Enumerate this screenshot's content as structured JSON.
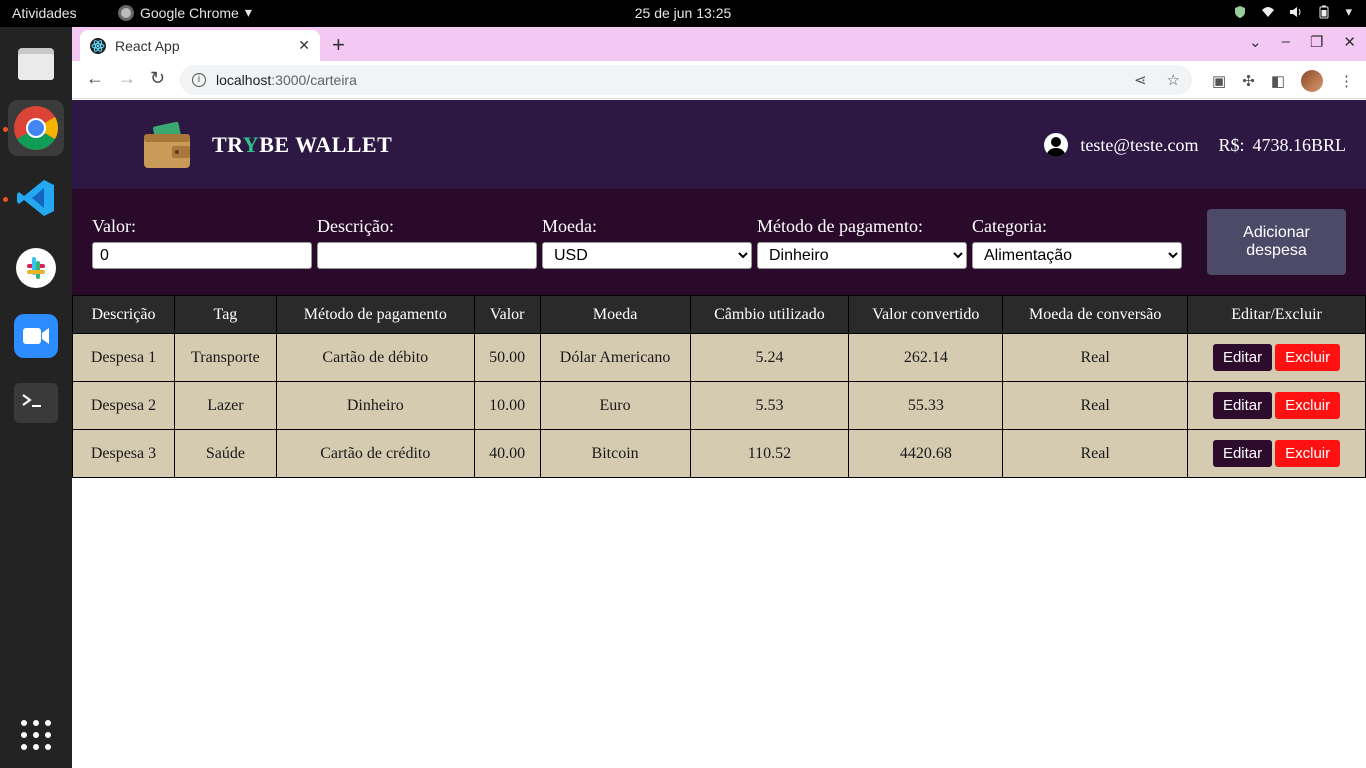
{
  "system": {
    "activities": "Atividades",
    "app_name": "Google Chrome",
    "clock": "25 de jun  13:25"
  },
  "browser": {
    "tab_title": "React App",
    "url_host": "localhost",
    "url_path": ":3000/carteira"
  },
  "header": {
    "brand_prefix": "TR",
    "brand_y": "Y",
    "brand_suffix": "BE WALLET",
    "email": "teste@teste.com",
    "total_label": "R$:",
    "total_value": "4738.16BRL"
  },
  "form": {
    "value_label": "Valor:",
    "value_input": "0",
    "description_label": "Descrição:",
    "description_input": "",
    "currency_label": "Moeda:",
    "currency_selected": "USD",
    "method_label": "Método de pagamento:",
    "method_selected": "Dinheiro",
    "category_label": "Categoria:",
    "category_selected": "Alimentação",
    "add_button_line1": "Adicionar",
    "add_button_line2": "despesa"
  },
  "table": {
    "headers": [
      "Descrição",
      "Tag",
      "Método de pagamento",
      "Valor",
      "Moeda",
      "Câmbio utilizado",
      "Valor convertido",
      "Moeda de conversão",
      "Editar/Excluir"
    ],
    "edit_label": "Editar",
    "delete_label": "Excluir",
    "rows": [
      [
        "Despesa 1",
        "Transporte",
        "Cartão de débito",
        "50.00",
        "Dólar Americano",
        "5.24",
        "262.14",
        "Real"
      ],
      [
        "Despesa 2",
        "Lazer",
        "Dinheiro",
        "10.00",
        "Euro",
        "5.53",
        "55.33",
        "Real"
      ],
      [
        "Despesa 3",
        "Saúde",
        "Cartão de crédito",
        "40.00",
        "Bitcoin",
        "110.52",
        "4420.68",
        "Real"
      ]
    ]
  },
  "colors": {
    "header_bg": "#2d1843",
    "form_bg": "#2a0a2a",
    "row_bg": "#d5cbb0",
    "edit_btn": "#2d0b2d",
    "delete_btn": "#ff1111",
    "brand_accent": "#2fc18c"
  }
}
